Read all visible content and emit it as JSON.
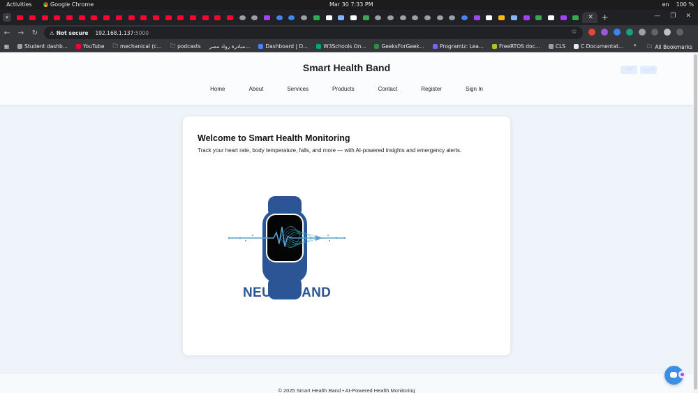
{
  "system": {
    "activities": "Activities",
    "app_name": "Google Chrome",
    "clock": "Mar 30   7:33 PM",
    "lang": "en",
    "battery": "100 %"
  },
  "browser": {
    "url_warning": "Not secure",
    "url_host": "192.168.1.137",
    "url_port": ":5000",
    "bookmarks": [
      "Student dashb...",
      "YouTube",
      "mechanical (c...",
      "podcasts",
      "مبادرة رواد مصر...",
      "Dashboard | D...",
      "W3Schools On...",
      "GeeksForGeek...",
      "Programiz: Lea...",
      "FreeRTOS doc...",
      "CLS",
      "C Documentat..."
    ],
    "all_bookmarks": "All Bookmarks"
  },
  "site": {
    "title": "Smart Health Band",
    "lang_en": "EN",
    "lang_ar": "العربية",
    "nav": [
      "Home",
      "About",
      "Services",
      "Products",
      "Contact",
      "Register",
      "Sign In"
    ],
    "welcome_title": "Welcome to Smart Health Monitoring",
    "welcome_text": "Track your heart rate, body temperature, falls, and more — with AI-powered insights and emergency alerts.",
    "logo_text": "NEUROBAND",
    "footer": "© 2025 Smart Health Band • AI-Powered Health Monitoring"
  },
  "colors": {
    "brand_blue": "#2b5595",
    "chat_button": "#3b8fe4"
  }
}
